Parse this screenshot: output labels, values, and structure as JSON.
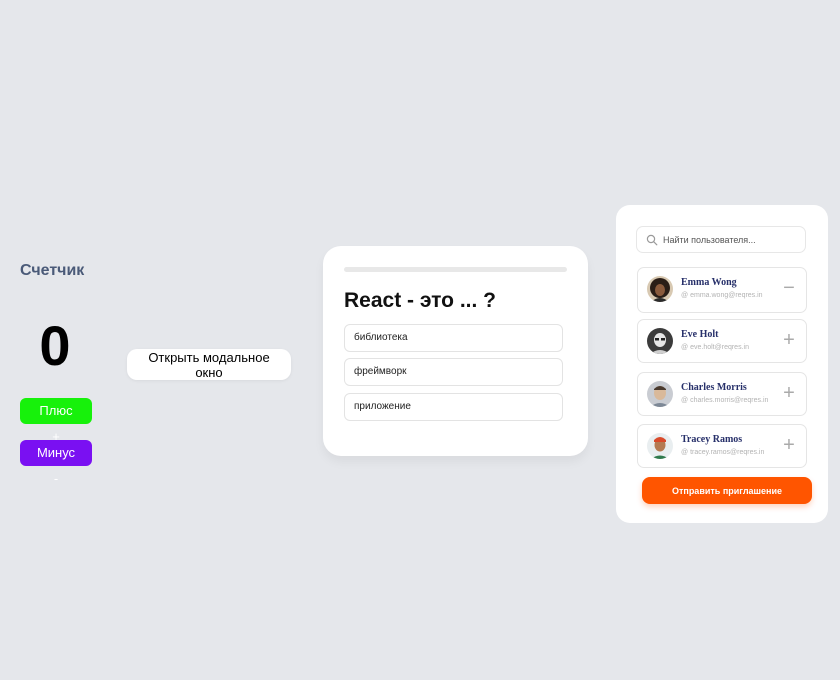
{
  "counter": {
    "title": "Счетчик",
    "value": "0",
    "plus_label": "Плюс +",
    "minus_label": "Минус -"
  },
  "modal": {
    "open_label": "Открыть модальное окно"
  },
  "quiz": {
    "question": "React - это ... ?",
    "options": [
      "библиотека",
      "фреймворк",
      "приложение"
    ]
  },
  "users": {
    "search_placeholder": "Найти пользователя...",
    "list": [
      {
        "name": "Emma Wong",
        "email": "emma.wong@reqres.in",
        "action": "−"
      },
      {
        "name": "Eve Holt",
        "email": "eve.holt@reqres.in",
        "action": "+"
      },
      {
        "name": "Charles Morris",
        "email": "charles.morris@reqres.in",
        "action": "+"
      },
      {
        "name": "Tracey Ramos",
        "email": "tracey.ramos@reqres.in",
        "action": "+"
      }
    ],
    "send_label": "Отправить приглашение"
  },
  "colors": {
    "background": "#e5e7eb",
    "plus": "#17f10b",
    "minus": "#7a10f2",
    "send": "#ff5500"
  }
}
